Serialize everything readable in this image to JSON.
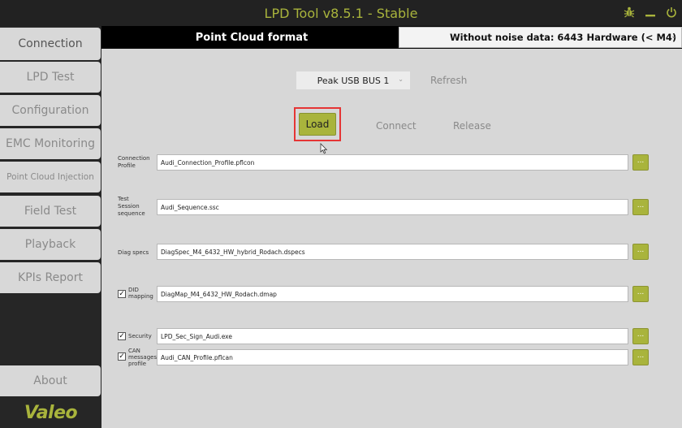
{
  "app": {
    "title": "LPD Tool v8.5.1 - Stable"
  },
  "sidebar": {
    "items": [
      {
        "label": "Connection"
      },
      {
        "label": "LPD Test"
      },
      {
        "label": "Configuration"
      },
      {
        "label": "EMC Monitoring"
      },
      {
        "label": "Point Cloud Injection"
      },
      {
        "label": "Field Test"
      },
      {
        "label": "Playback"
      },
      {
        "label": "KPIs Report"
      }
    ],
    "about_label": "About",
    "logo_text": "Valeo"
  },
  "header": {
    "title": "Point Cloud format",
    "mode_selected": "Without noise data: 6443 Hardware (< M4)"
  },
  "connection": {
    "bus_selected": "Peak USB BUS 1",
    "refresh_label": "Refresh",
    "load_label": "Load",
    "connect_label": "Connect",
    "release_label": "Release"
  },
  "files": {
    "connection_profile": {
      "label": "Connection Profile",
      "value": "Audi_Connection_Profile.pflcon"
    },
    "test_session": {
      "label": "Test Session sequence",
      "value": "Audi_Sequence.ssc"
    },
    "diag_specs": {
      "label": "Diag specs",
      "value": "DiagSpec_M4_6432_HW_hybrid_Rodach.dspecs"
    },
    "did_mapping": {
      "label": "DID mapping",
      "value": "DiagMap_M4_6432_HW_Rodach.dmap",
      "checked": true
    },
    "security": {
      "label": "Security",
      "value": "LPD_Sec_Sign_Audi.exe",
      "checked": true
    },
    "can_profile": {
      "label": "CAN messages profile",
      "value": "Audi_CAN_Profile.pflcan",
      "checked": true
    }
  },
  "browse_label": "...",
  "colors": {
    "accent": "#a9b43c",
    "titlebar": "#222222",
    "highlight_frame": "#e53535"
  }
}
